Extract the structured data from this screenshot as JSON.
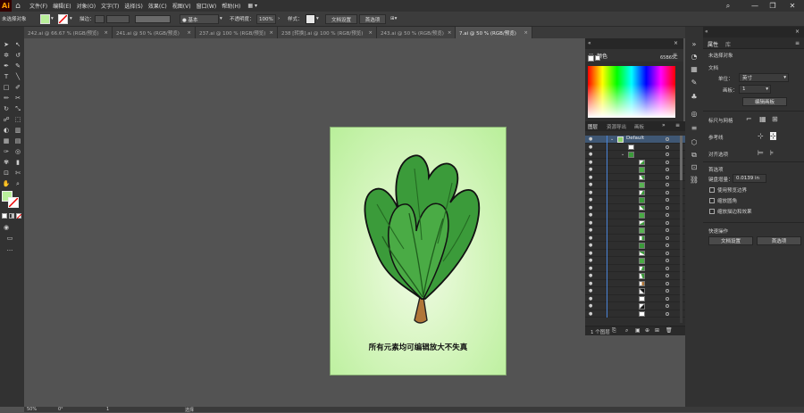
{
  "app": {
    "logo": "Ai",
    "home_icon": "home-icon"
  },
  "menu": [
    "文件(F)",
    "编辑(E)",
    "对象(O)",
    "文字(T)",
    "选择(S)",
    "效果(C)",
    "视图(V)",
    "窗口(W)",
    "帮助(H)"
  ],
  "window_controls": {
    "search": "⌕",
    "minimize": "—",
    "maximize": "❐",
    "close": "✕"
  },
  "control_bar": {
    "selection_label": "未选择对象",
    "stroke_label": "描边：",
    "brush_value": "● 基本",
    "opacity_label": "不透明度：",
    "opacity_value": "100%",
    "style_label": "样式：",
    "doc_setup": "文档设置",
    "prefs": "首选项",
    "fill_color": "#b9ef9a"
  },
  "tabs": [
    {
      "label": "242.ai @ 66.67 % (RGB/预览)",
      "active": false
    },
    {
      "label": "241.ai @ 50 % (RGB/预览)",
      "active": false
    },
    {
      "label": "237.ai @ 100 % (RGB/预览)",
      "active": false
    },
    {
      "label": "238 [转换].ai @ 100 % (RGB/预览)",
      "active": false
    },
    {
      "label": "243.ai @ 50 % (RGB/预览)",
      "active": false
    },
    {
      "label": "7.ai @ 50 % (RGB/预览)",
      "active": true
    }
  ],
  "artboard": {
    "caption": "所有元素均可编辑放大不失真"
  },
  "color_panel": {
    "title": "颜色",
    "hex": "65B65C"
  },
  "layers_panel": {
    "tabs": [
      "图层",
      "资源导出",
      "画板"
    ],
    "root_layer": "Default",
    "footer_count": "1 个图层"
  },
  "properties": {
    "tabs": [
      "属性",
      "库"
    ],
    "selection": "未选择对象",
    "document": "文档",
    "units_label": "单位：",
    "units_value": "英寸",
    "artboard_label": "画板：",
    "artboard_value": "1",
    "edit_artboards": "编辑画板",
    "rulers": "标尺与网格",
    "guides": "参考线",
    "align": "对齐选项",
    "prefs_title": "首选项",
    "keyboard_increment_label": "键盘增量：",
    "keyboard_increment_value": "0.0139 in",
    "check_preview_bounds": "使用预览边界",
    "check_scale_corners": "缩放圆角",
    "check_scale_strokes": "缩放描边和效果",
    "quick_actions": "快速操作",
    "doc_setup_btn": "文档设置",
    "prefs_btn": "首选项"
  },
  "status": {
    "zoom": "50%",
    "rotate": "0°",
    "page": "1",
    "tool": "选择"
  }
}
